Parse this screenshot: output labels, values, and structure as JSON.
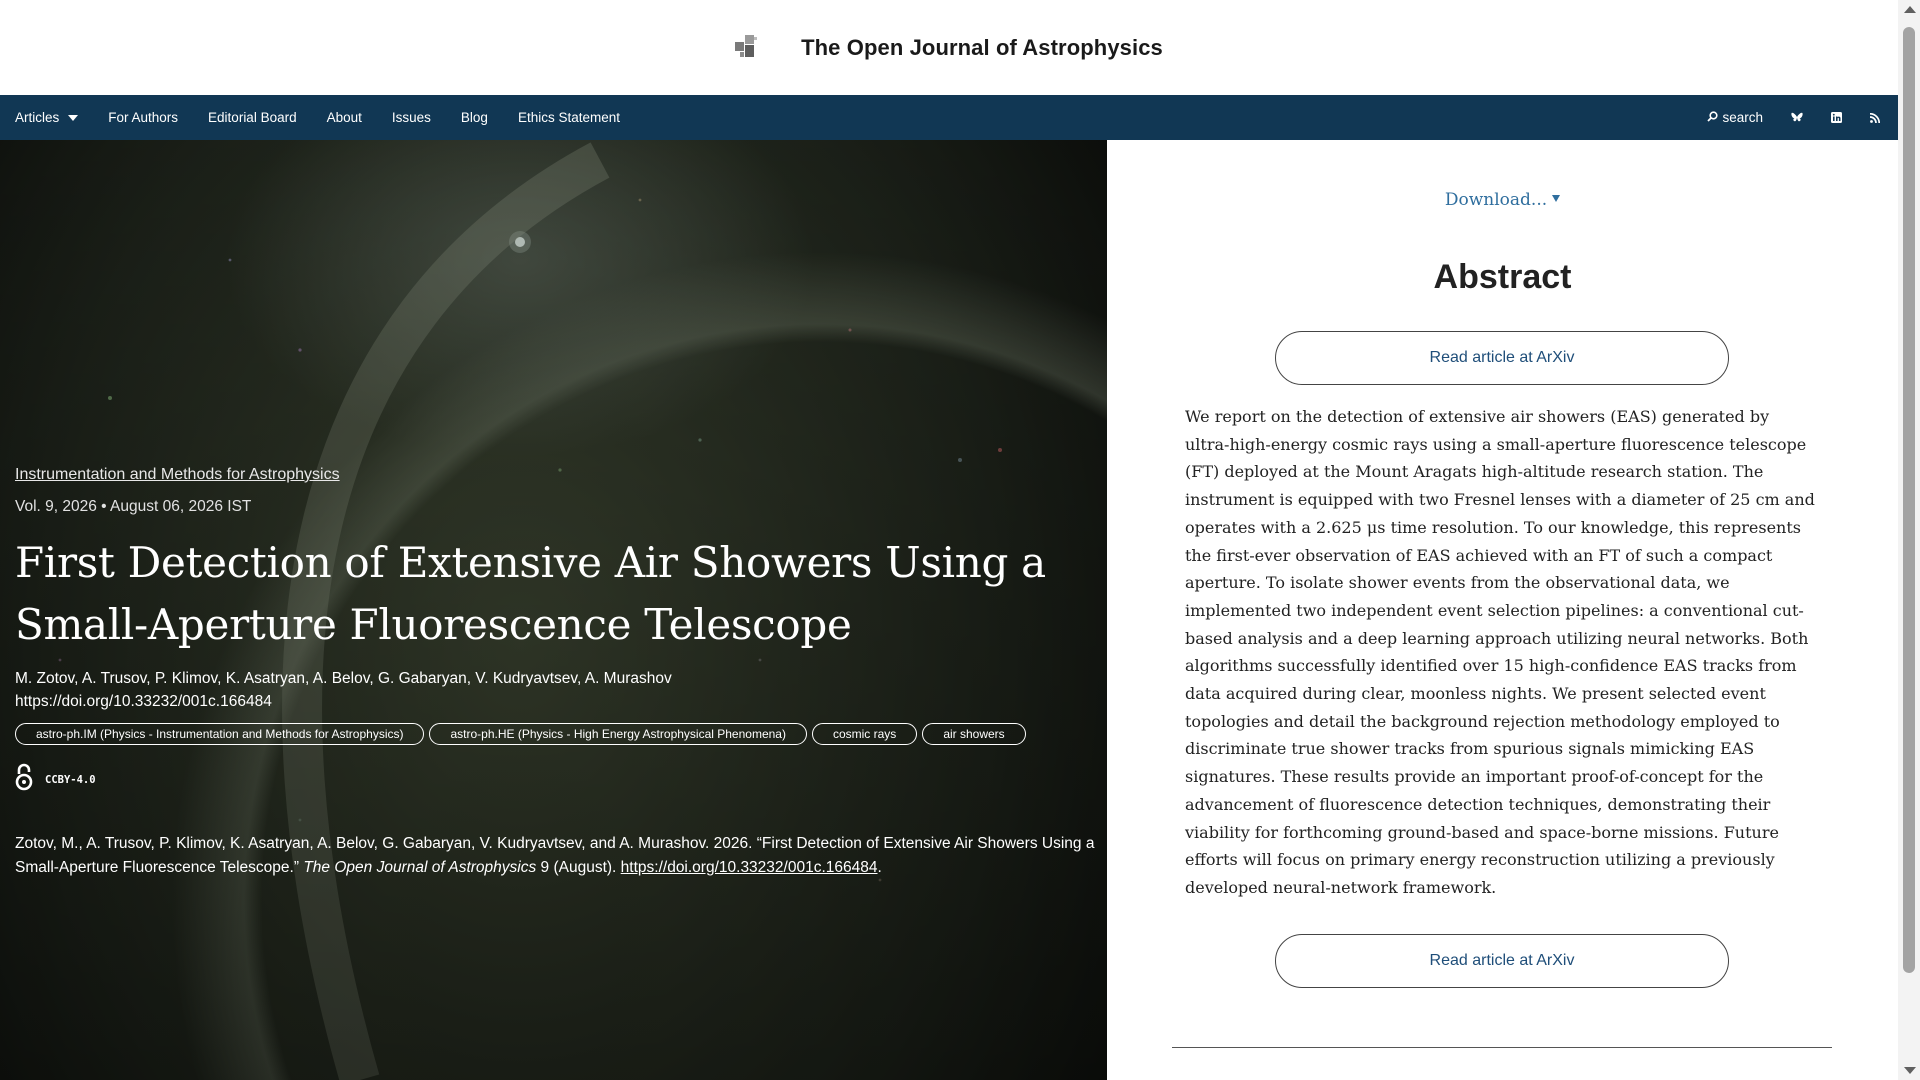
{
  "header": {
    "site_title": "The Open Journal of Astrophysics",
    "logo_icon": "journal-logo-icon"
  },
  "navbar": {
    "items": [
      {
        "label": "Articles",
        "dropdown": true
      },
      {
        "label": "For Authors"
      },
      {
        "label": "Editorial Board"
      },
      {
        "label": "About"
      },
      {
        "label": "Issues"
      },
      {
        "label": "Blog"
      },
      {
        "label": "Ethics Statement"
      }
    ],
    "search_label": "search",
    "icons": [
      "bluesky-icon",
      "linkedin-icon",
      "rss-icon"
    ]
  },
  "article": {
    "category": "Instrumentation and Methods for Astrophysics",
    "meta": "Vol. 9, 2026 • August 06, 2026 IST",
    "title": "First Detection of Extensive Air Showers Using a Small-Aperture Fluorescence Telescope",
    "authors": "M. Zotov, A. Trusov, P. Klimov, K. Asatryan, A. Belov, G. Gabaryan, V. Kudryavtsev, A. Murashov",
    "doi": "https://doi.org/10.33232/001c.166484",
    "tags": [
      "astro-ph.IM (Physics - Instrumentation and Methods for Astrophysics)",
      "astro-ph.HE (Physics - High Energy Astrophysical Phenomena)",
      "cosmic rays",
      "air showers"
    ],
    "license": "CCBY-4.0",
    "citation": {
      "text_before": "Zotov, M., A. Trusov, P. Klimov, K. Asatryan, A. Belov, G. Gabaryan, V. Kudryavtsev, and A. Murashov. 2026. “First Detection of Extensive Air Showers Using a Small-Aperture Fluorescence Telescope.” ",
      "journal": "The Open Journal of Astrophysics",
      "text_middle": " 9 (August). ",
      "link": "https://doi.org/10.33232/001c.166484",
      "text_after": "."
    }
  },
  "right_panel": {
    "download_label": "Download...",
    "abstract_heading": "Abstract",
    "arxiv_button": "Read article at ArXiv",
    "abstract": "We report on the detection of extensive air showers (EAS) generated by ultra-high-energy cosmic rays using a small-aperture fluorescence telescope (FT) deployed at the Mount Aragats high-altitude research station. The instrument is equipped with two Fresnel lenses with a diameter of 25 cm and operates with a 2.625 μs time resolution. To our knowledge, this represents the first-ever observation of EAS achieved with an FT of such a compact aperture. To isolate shower events from the observational data, we implemented two independent event selection pipelines: a conventional cut-based analysis and a deep learning approach utilizing neural networks. Both algorithms successfully identified over 15 high-confidence EAS tracks from data acquired during clear, moonless nights. We present selected event topologies and detail the background rejection methodology employed to discriminate true shower tracks from spurious signals mimicking EAS signatures. These results provide an important proof-of-concept for the advancement of fluorescence detection techniques, demonstrating their viability for forthcoming ground-based and space-borne missions. Future efforts will focus on primary energy reconstruction utilizing a previously developed neural-network framework."
  },
  "colors": {
    "navbar_bg": "#113754",
    "link_blue": "#2f6e9e",
    "button_text": "#1f4e79"
  }
}
